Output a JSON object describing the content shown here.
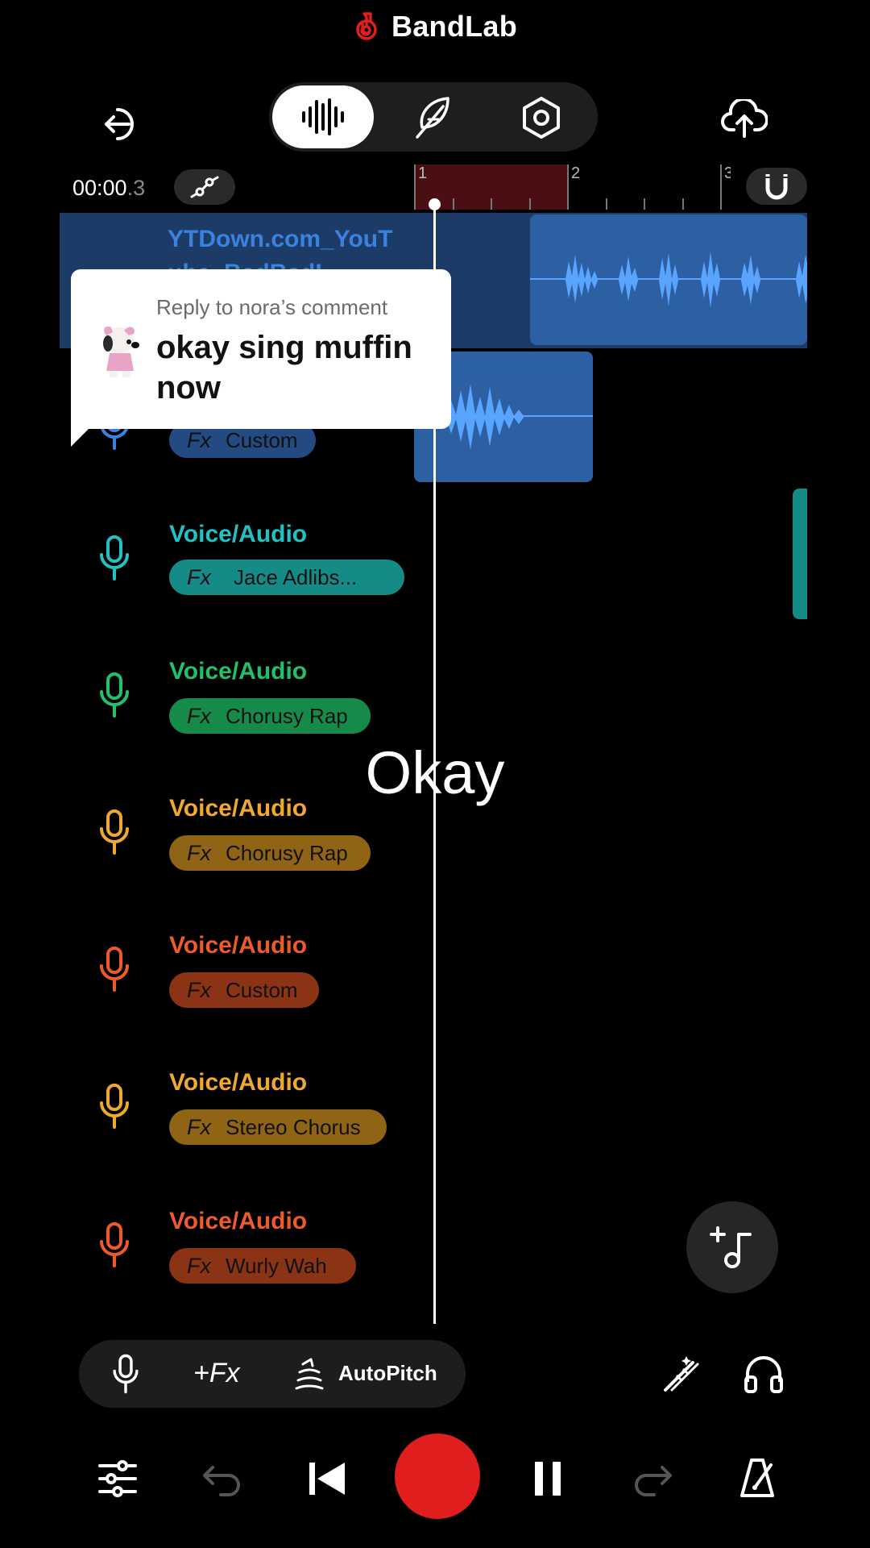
{
  "header": {
    "brand": "BandLab",
    "brand_color": "#e01e1e",
    "exit_icon": "exit-icon",
    "upload_icon": "cloud-upload-icon",
    "view_modes": [
      {
        "name": "waveform-icon",
        "active": true
      },
      {
        "name": "feather-icon",
        "active": false
      },
      {
        "name": "settings-hex-icon",
        "active": false
      }
    ]
  },
  "timeline": {
    "time_main": "00:00",
    "time_fraction": ".3",
    "bar_labels": [
      "1",
      "2",
      "3"
    ]
  },
  "tracks": [
    {
      "name": "YTDown.com_YouT",
      "name_line2": "ube_BadBadL...",
      "color": "#3b82e0",
      "fx": "",
      "selected": true
    },
    {
      "name": "",
      "color": "#3b82e0",
      "fx": "Custom",
      "pill_color": "#234b82"
    },
    {
      "name": "Voice/Audio",
      "color": "#22c1c3",
      "fx": "Jace Adlibs...",
      "pill_color": "#158b88"
    },
    {
      "name": "Voice/Audio",
      "color": "#22c06a",
      "fx": "Chorusy Rap",
      "pill_color": "#168a49"
    },
    {
      "name": "Voice/Audio",
      "color": "#f0a92e",
      "fx": "Chorusy Rap",
      "pill_color": "#8f6414"
    },
    {
      "name": "Voice/Audio",
      "color": "#ee5a2a",
      "fx": "Custom",
      "pill_color": "#8a3315"
    },
    {
      "name": "Voice/Audio",
      "color": "#f0a92e",
      "fx": "Stereo Chorus",
      "pill_color": "#8f6414"
    },
    {
      "name": "Voice/Audio",
      "color": "#ee5a2a",
      "fx": "Wurly Wah",
      "pill_color": "#8a3315"
    }
  ],
  "fx_tag": "Fx",
  "comment": {
    "label": "Reply to nora’s comment",
    "text": "okay sing muffin now"
  },
  "caption": "Okay",
  "toolbar": {
    "mic_icon": "mic-icon",
    "add_fx": "+Fx",
    "autopitch": "AutoPitch"
  },
  "transport": {
    "mixer_icon": "sliders-icon",
    "undo_icon": "undo-icon",
    "back_icon": "skip-back-icon",
    "record_icon": "record-icon",
    "pause_icon": "pause-icon",
    "redo_icon": "redo-icon",
    "metronome_icon": "metronome-icon"
  }
}
